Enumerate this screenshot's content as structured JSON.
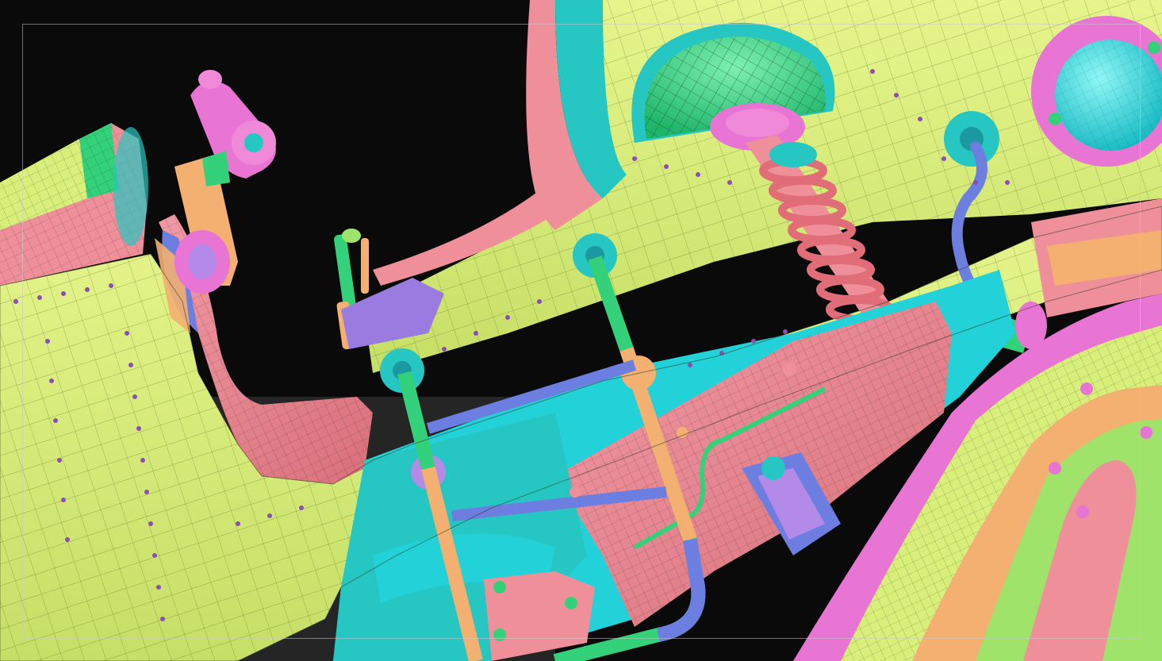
{
  "viewport": {
    "mode": "polygroups-wireframe",
    "background": "#0a0a0a"
  },
  "palette": {
    "yellow_green": "#d8f07a",
    "pink": "#ef8f9a",
    "salmon": "#e7807c",
    "cyan": "#22d2d8",
    "teal": "#26c6c2",
    "green": "#33d27a",
    "lime": "#9fe36a",
    "purple": "#9a7be0",
    "violet": "#b48ae8",
    "magenta": "#e874d4",
    "orange": "#f3b070",
    "blue": "#6c7fe0",
    "wire": "#2a2a2a"
  },
  "parts": [
    "hull-panel",
    "cockpit-opening",
    "ladder",
    "dome-hatch",
    "coil-spring",
    "hydraulic-pipe",
    "porthole",
    "control-lever",
    "intake-pipe",
    "rivet-rows",
    "bolt-heads",
    "engine-bay"
  ]
}
